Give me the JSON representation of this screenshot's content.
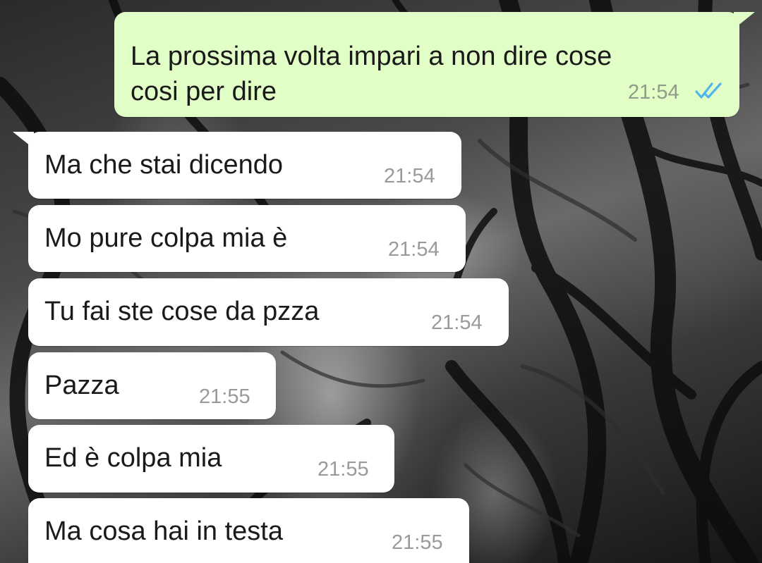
{
  "chat": {
    "messages": [
      {
        "direction": "outgoing",
        "lines": [
          "La prossima volta impari a non dire cose",
          "cosi per dire"
        ],
        "time": "21:54",
        "status_icon": "double-check-read-icon",
        "status_color": "#4fb6ec"
      },
      {
        "direction": "incoming",
        "text": "Ma che stai dicendo",
        "time": "21:54"
      },
      {
        "direction": "incoming",
        "text": "Mo pure colpa mia è",
        "time": "21:54"
      },
      {
        "direction": "incoming",
        "text": "Tu fai ste cose da pzza",
        "time": "21:54"
      },
      {
        "direction": "incoming",
        "text": "Pazza",
        "time": "21:55"
      },
      {
        "direction": "incoming",
        "text": "Ed è colpa mia",
        "time": "21:55"
      },
      {
        "direction": "incoming",
        "text": "Ma cosa hai in testa",
        "time": "21:55"
      }
    ]
  },
  "colors": {
    "outgoing_bubble": "#e1fec6",
    "incoming_bubble": "#ffffff",
    "timestamp": "#9a9a9a",
    "read_ticks": "#4fb6ec"
  }
}
